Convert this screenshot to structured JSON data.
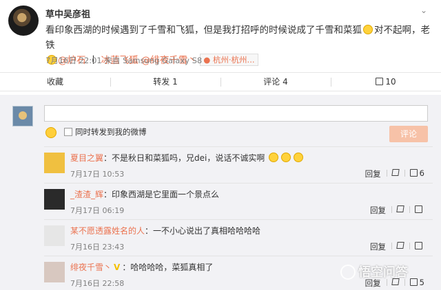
{
  "post": {
    "author": "草中吴彦祖",
    "text_1": "看印象西湖的时候遇到了千雪和飞狐，但是我打招呼的时候说成了千雪和菜狐",
    "text_2": "对不起啊，老铁",
    "mention_1": "@炉石",
    "separator": "丨",
    "link_text": "冰蓝飞狐",
    "mention_2": "@绯夜千雪丶",
    "location": "杭州·杭州...",
    "time": "7月16日 22:01",
    "source_prefix": "来自",
    "source": "Samsung Galaxy S8",
    "more_icon": "chevron-down-icon"
  },
  "actions": {
    "favorite": "收藏",
    "repost": "转发 1",
    "comment": "评论 4",
    "like": "10"
  },
  "composer": {
    "placeholder": "",
    "also_repost": "同时转发到我的微博",
    "submit": "评论"
  },
  "comments": [
    {
      "name": "夏目之翼",
      "text": "：不是秋日和菜狐吗，兄dei，说话不诚实啊",
      "time": "7月17日 10:53",
      "reply": "回复",
      "likes": "6",
      "avatar_color": "#f0c040"
    },
    {
      "name": "_渣渣_辉",
      "text": "：印象西湖是它里面一个景点么",
      "time": "7月17日 06:19",
      "reply": "回复",
      "likes": "",
      "avatar_color": "#2a2a2a"
    },
    {
      "name": "某不愿透露姓名的人",
      "text": "：一不小心说出了真相哈哈哈哈",
      "time": "7月16日 23:43",
      "reply": "回复",
      "likes": "",
      "avatar_color": "#e6e6e6"
    },
    {
      "name": "绯夜千雪丶",
      "text": "：哈哈哈哈，菜狐真相了",
      "time": "7月16日 22:58",
      "reply": "回复",
      "likes": "5",
      "avatar_color": "#d8c8c0"
    }
  ],
  "watermark": "悟空问答"
}
